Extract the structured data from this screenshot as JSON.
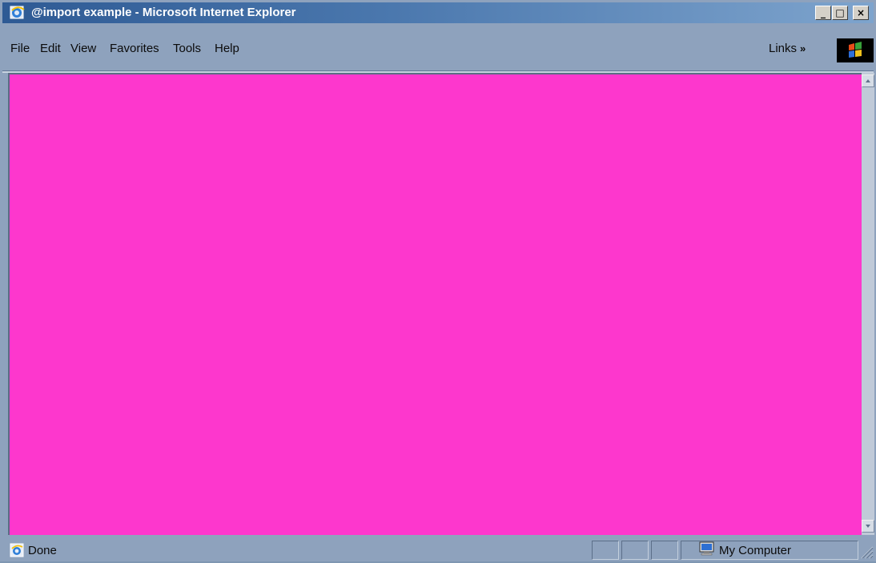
{
  "window": {
    "title": "@import example - Microsoft Internet Explorer",
    "controls": {
      "minimize": "_",
      "maximize": "□",
      "close": "×"
    }
  },
  "menu": {
    "items": [
      "File",
      "Edit",
      "View",
      "Favorites",
      "Tools",
      "Help"
    ],
    "links_label": "Links",
    "links_chevron": "»"
  },
  "content": {
    "background_color": "#fd37cd"
  },
  "status": {
    "text": "Done",
    "zone": "My Computer"
  },
  "icons": {
    "title": "ie-logo-icon",
    "brand": "windows-logo-icon",
    "status": "ie-page-icon",
    "zone": "my-computer-icon"
  },
  "colors": {
    "titlebar": "#2e5a94",
    "chrome": "#8ea2bd",
    "page": "#fd37cd"
  }
}
